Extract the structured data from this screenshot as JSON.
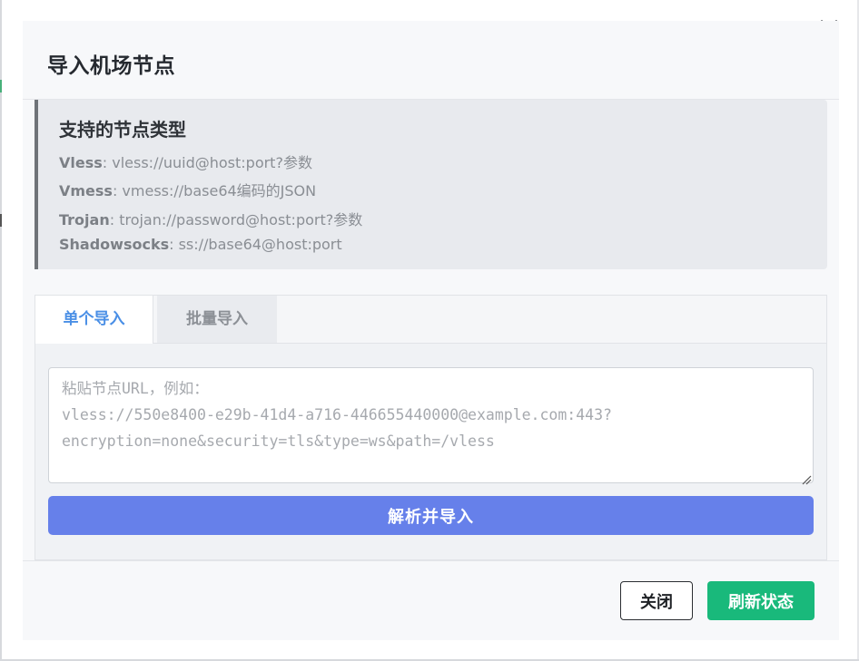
{
  "dialog": {
    "title": "导入机场节点",
    "close_icon": "close-icon"
  },
  "info": {
    "title": "支持的节点类型",
    "items": [
      {
        "label": "Vless",
        "value": ": vless://uuid@host:port?参数"
      },
      {
        "label": "Vmess",
        "value": ": vmess://base64编码的JSON"
      },
      {
        "label": "Trojan",
        "value": ": trojan://password@host:port?参数"
      },
      {
        "label": "Shadowsocks",
        "value": ": ss://base64@host:port"
      }
    ]
  },
  "tabs": [
    {
      "label": "单个导入",
      "active": true
    },
    {
      "label": "批量导入",
      "active": false
    }
  ],
  "import": {
    "value": "",
    "placeholder": "粘贴节点URL，例如：\nvless://550e8400-e29b-41d4-a716-446655440000@example.com:443?\nencryption=none&security=tls&type=ws&path=/vless",
    "submit_label": "解析并导入"
  },
  "footer": {
    "close_label": "关闭",
    "refresh_label": "刷新状态"
  },
  "colors": {
    "primary": "#6680ea",
    "success": "#19b97b",
    "active_tab_text": "#4a8fe6"
  }
}
